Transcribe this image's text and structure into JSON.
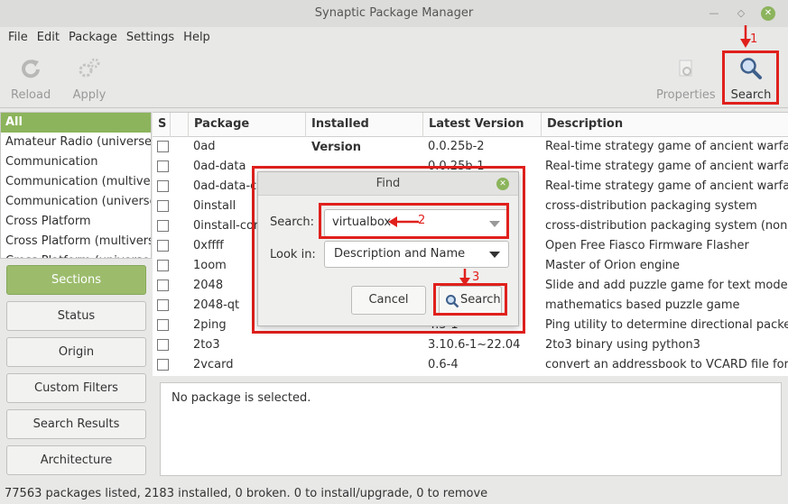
{
  "window": {
    "title": "Synaptic Package Manager"
  },
  "menu": [
    "File",
    "Edit",
    "Package",
    "Settings",
    "Help"
  ],
  "toolbar": {
    "reload": "Reload",
    "apply": "Apply",
    "properties": "Properties",
    "search": "Search"
  },
  "sections": {
    "items": [
      "All",
      "Amateur Radio (universe)",
      "Communication",
      "Communication (multiverse)",
      "Communication (universe)",
      "Cross Platform",
      "Cross Platform (multiverse)",
      "Cross Platform (universe)"
    ],
    "buttons": [
      "Sections",
      "Status",
      "Origin",
      "Custom Filters",
      "Search Results",
      "Architecture"
    ]
  },
  "table": {
    "headers": {
      "s": "S",
      "package": "Package",
      "installed": "Installed Version",
      "latest": "Latest Version",
      "description": "Description"
    },
    "rows": [
      {
        "package": "0ad",
        "latest": "0.0.25b-2",
        "description": "Real-time strategy game of ancient warfare"
      },
      {
        "package": "0ad-data",
        "latest": "0.0.25b-1",
        "description": "Real-time strategy game of ancient warfare (d"
      },
      {
        "package": "0ad-data-co",
        "latest": "",
        "description": "Real-time strategy game of ancient warfare (c"
      },
      {
        "package": "0install",
        "latest": "",
        "description": "cross-distribution packaging system"
      },
      {
        "package": "0install-core",
        "latest": "",
        "description": "cross-distribution packaging system (non-GU"
      },
      {
        "package": "0xffff",
        "latest": "",
        "description": "Open Free Fiasco Firmware Flasher"
      },
      {
        "package": "1oom",
        "latest": "",
        "description": "Master of Orion engine"
      },
      {
        "package": "2048",
        "latest": "3-1",
        "description": "Slide and add puzzle game for text mode"
      },
      {
        "package": "2048-qt",
        "latest": "",
        "description": "mathematics based puzzle game"
      },
      {
        "package": "2ping",
        "latest": "4.5-1",
        "description": "Ping utility to determine directional packet lo"
      },
      {
        "package": "2to3",
        "latest": "3.10.6-1~22.04",
        "description": "2to3 binary using python3"
      },
      {
        "package": "2vcard",
        "latest": "0.6-4",
        "description": "convert an addressbook to VCARD file forma"
      }
    ]
  },
  "detail": "No package is selected.",
  "status": "77563 packages listed, 2183 installed, 0 broken. 0 to install/upgrade, 0 to remove",
  "find_dialog": {
    "title": "Find",
    "search_label": "Search:",
    "search_value": "virtualbox",
    "lookin_label": "Look in:",
    "lookin_value": "Description and Name",
    "cancel": "Cancel",
    "search_button": "Search"
  },
  "annotations": {
    "step1": "1",
    "step2": "2",
    "step3": "3"
  },
  "colors": {
    "accent": "#8cb45c",
    "highlight": "#e0201c"
  }
}
